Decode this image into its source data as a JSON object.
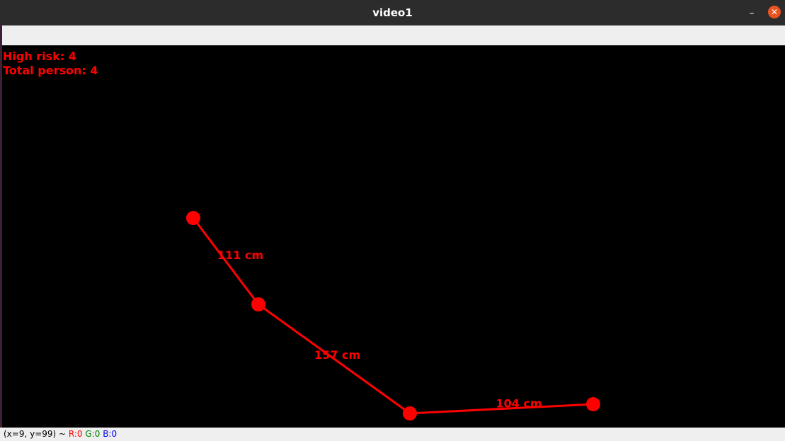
{
  "window": {
    "title": "video1",
    "minimize_glyph": "–",
    "close_glyph": "✕"
  },
  "overlay": {
    "high_risk": "High risk: 4",
    "total_person": "Total person: 4",
    "color": "#ff0000"
  },
  "persons": [
    {
      "id": 1
    },
    {
      "id": 2
    },
    {
      "id": 3
    },
    {
      "id": 4
    }
  ],
  "connections": [
    {
      "from": 0,
      "to": 1,
      "label": "111 cm"
    },
    {
      "from": 1,
      "to": 2,
      "label": "157 cm"
    },
    {
      "from": 2,
      "to": 3,
      "label": "104 cm"
    }
  ],
  "status": {
    "coords": "(x=9, y=99) ~",
    "r": "R:0",
    "g": "G:0",
    "b": "B:0",
    "r_color": "#ff0000",
    "g_color": "#008000",
    "b_color": "#0000ff"
  }
}
